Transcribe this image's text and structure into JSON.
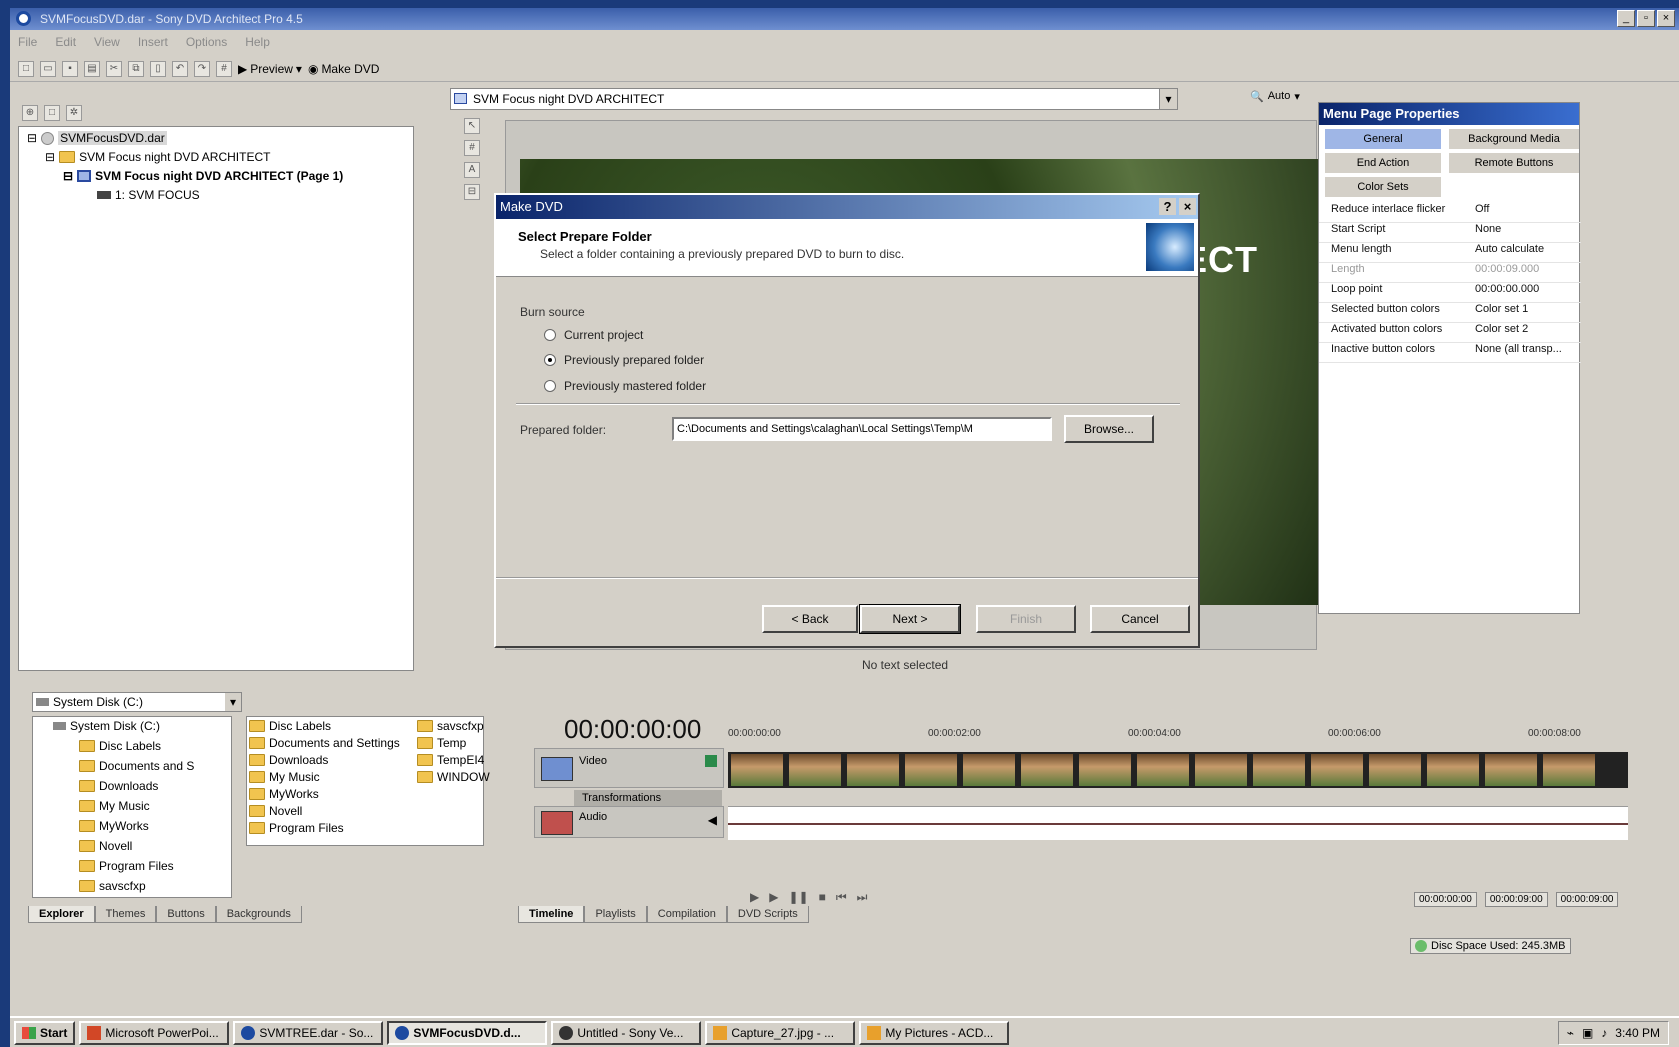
{
  "app": {
    "title": "SVMFocusDVD.dar - Sony DVD Architect Pro 4.5",
    "menu": [
      "File",
      "Edit",
      "View",
      "Insert",
      "Options",
      "Help"
    ],
    "toolbar": {
      "preview": "Preview",
      "make_dvd": "Make DVD"
    }
  },
  "project_tree": {
    "root": "SVMFocusDVD.dar",
    "items": [
      {
        "label": "SVM Focus night   DVD ARCHITECT"
      },
      {
        "label": "SVM Focus night   DVD ARCHITECT (Page 1)"
      },
      {
        "label": "1: SVM FOCUS"
      }
    ]
  },
  "workspace": {
    "combo": "SVM Focus night   DVD ARCHITECT",
    "zoom": "Auto",
    "preview_text": "TECT",
    "status": "No text selected"
  },
  "properties": {
    "title": "Menu Page Properties",
    "tabs": [
      "General",
      "Background Media",
      "End Action",
      "Remote Buttons",
      "Color Sets"
    ],
    "rows": [
      {
        "name": "Reduce interlace flicker",
        "value": "Off"
      },
      {
        "name": "Start Script",
        "value": "None"
      },
      {
        "name": "Menu length",
        "value": "Auto calculate"
      },
      {
        "name": "Length",
        "value": "00:00:09.000"
      },
      {
        "name": "Loop point",
        "value": "00:00:00.000"
      },
      {
        "name": "Selected button colors",
        "value": "Color set 1"
      },
      {
        "name": "Activated button colors",
        "value": "Color set 2"
      },
      {
        "name": "Inactive button colors",
        "value": "None (all transp..."
      }
    ]
  },
  "dialog": {
    "title": "Make DVD",
    "help": "?",
    "close": "×",
    "heading": "Select Prepare Folder",
    "subheading": "Select a folder containing a previously prepared DVD to burn to disc.",
    "burn_source_label": "Burn source",
    "options": [
      "Current project",
      "Previously prepared folder",
      "Previously mastered folder"
    ],
    "selected_option": 1,
    "folder_label": "Prepared folder:",
    "folder_value": "C:\\Documents and Settings\\calaghan\\Local Settings\\Temp\\M",
    "browse": "Browse...",
    "back": "< Back",
    "next": "Next >",
    "finish": "Finish",
    "cancel": "Cancel"
  },
  "explorer": {
    "drive": "System Disk (C:)",
    "tree": [
      "System Disk (C:)",
      "Disc Labels",
      "Documents and S",
      "Downloads",
      "My Music",
      "MyWorks",
      "Novell",
      "Program Files",
      "savscfxp"
    ],
    "files_col1": [
      "Disc Labels",
      "Documents and Settings",
      "Downloads",
      "My Music",
      "MyWorks",
      "Novell",
      "Program Files"
    ],
    "files_col2": [
      "savscfxp",
      "Temp",
      "TempEI4",
      "WINDOW"
    ],
    "tabs": [
      "Explorer",
      "Themes",
      "Buttons",
      "Backgrounds"
    ]
  },
  "timeline": {
    "timecode": "00:00:00:00",
    "ruler": [
      "00:00:00:00",
      "00:00:02:00",
      "00:00:04:00",
      "00:00:06:00",
      "00:00:08:00"
    ],
    "tracks": {
      "video": "Video",
      "transformations": "Transformations",
      "audio": "Audio"
    },
    "readouts": [
      "00:00:00:00",
      "00:00:09:00",
      "00:00:09:00"
    ],
    "tabs": [
      "Timeline",
      "Playlists",
      "Compilation",
      "DVD Scripts"
    ]
  },
  "status_bar": {
    "disc_space": "Disc Space Used: 245.3MB"
  },
  "taskbar": {
    "start": "Start",
    "items": [
      "Microsoft PowerPoi...",
      "SVMTREE.dar - So...",
      "SVMFocusDVD.d...",
      "Untitled - Sony Ve...",
      "Capture_27.jpg - ...",
      "My Pictures - ACD..."
    ],
    "active_index": 2,
    "clock": "3:40 PM"
  }
}
